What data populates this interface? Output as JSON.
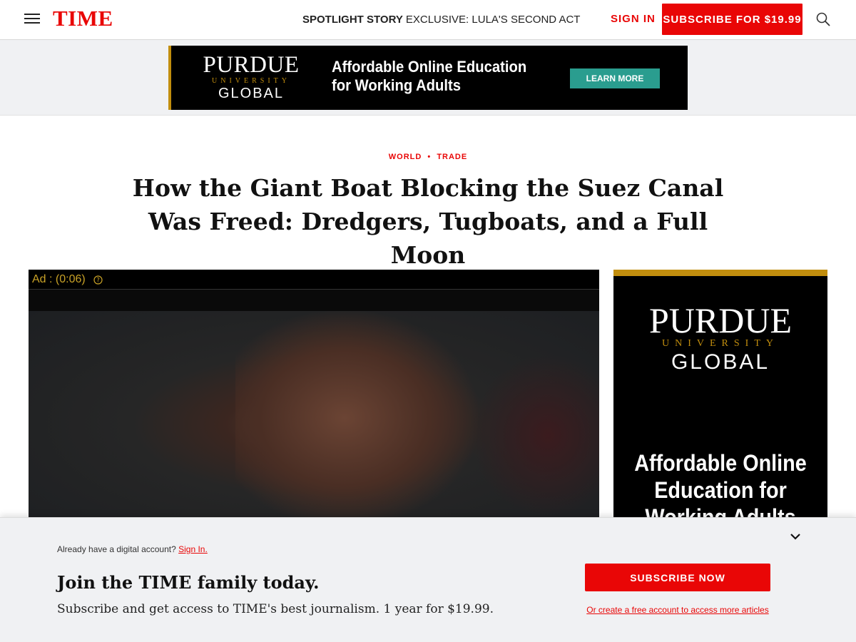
{
  "header": {
    "logo": "TIME",
    "spotlight_label": "SPOTLIGHT STORY",
    "spotlight_text": "EXCLUSIVE: LULA'S SECOND ACT",
    "sign_in": "SIGN IN",
    "subscribe": "SUBSCRIBE FOR $19.99",
    "menu_icon": "hamburger-menu-icon",
    "search_icon": "search-icon"
  },
  "top_ad": {
    "brand_name": "PURDUE",
    "brand_sub": "UNIVERSITY",
    "brand_global": "GLOBAL",
    "headline_line1": "Affordable Online Education",
    "headline_line2": "for Working Adults",
    "cta": "LEARN MORE"
  },
  "article": {
    "category_1": "WORLD",
    "category_separator": "•",
    "category_2": "TRADE",
    "title_line1": "How the Giant Boat Blocking the Suez Canal",
    "title_line2": "Was Freed: Dredgers, Tugboats, and a Full Moon"
  },
  "video": {
    "ad_timer": "Ad : (0:06)",
    "help_icon": "help-circle-icon"
  },
  "side_ad": {
    "brand_name": "PURDUE",
    "brand_sub": "UNIVERSITY",
    "brand_global": "GLOBAL",
    "headline_line1": "Affordable Online",
    "headline_line2": "Education for",
    "headline_line3": "Working Adults"
  },
  "drawer": {
    "already_text": "Already have a digital account?",
    "sign_in_link": "Sign In.",
    "join_title": "Join the TIME family today.",
    "join_sub": "Subscribe and get access to TIME's best journalism. 1 year for $19.99.",
    "subscribe_now": "SUBSCRIBE NOW",
    "free_account": "Or create a free account to access more articles",
    "collapse_icon": "chevron-down-icon"
  },
  "colors": {
    "brand_red": "#e90606",
    "purdue_gold": "#c28e0e",
    "cta_teal": "#2a9d8f"
  }
}
